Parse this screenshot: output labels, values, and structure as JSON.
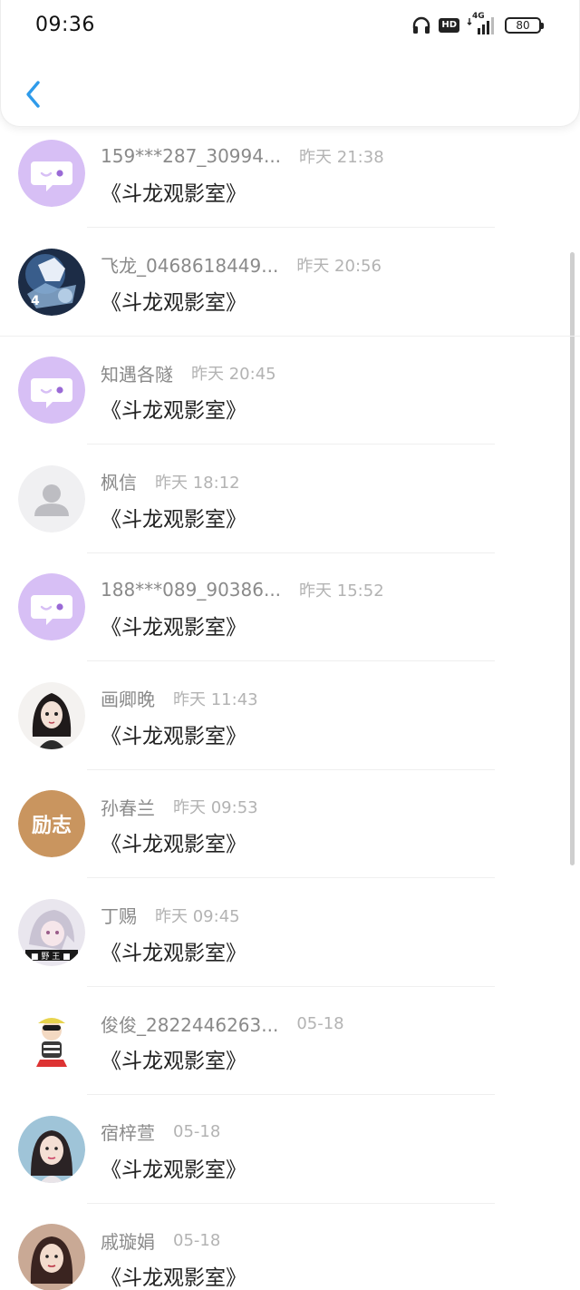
{
  "status_bar": {
    "time": "09:36",
    "icons": [
      "headphones-icon",
      "hd-icon",
      "signal-4g-icon"
    ],
    "hd_label": "HD",
    "network_label": "4G",
    "battery_level": "80"
  },
  "header": {
    "back_icon": "chevron-left-icon",
    "accent_color": "#2f9bea"
  },
  "conversations": [
    {
      "name": "159***287_30994...",
      "time": "昨天 21:38",
      "message": "《斗龙观影室》",
      "avatar": "default-chat-avatar"
    },
    {
      "name": "飞龙_0468618449...",
      "time": "昨天 20:56",
      "message": "《斗龙观影室》",
      "avatar": "anime-boy-avatar"
    },
    {
      "name": "知遇各隧",
      "time": "昨天 20:45",
      "message": "《斗龙观影室》",
      "avatar": "default-chat-avatar"
    },
    {
      "name": "枫信",
      "time": "昨天 18:12",
      "message": "《斗龙观影室》",
      "avatar": "default-person-avatar"
    },
    {
      "name": "188***089_90386...",
      "time": "昨天 15:52",
      "message": "《斗龙观影室》",
      "avatar": "default-chat-avatar"
    },
    {
      "name": "画卿晚",
      "time": "昨天 11:43",
      "message": "《斗龙观影室》",
      "avatar": "drawn-girl-avatar"
    },
    {
      "name": "孙春兰",
      "time": "昨天 09:53",
      "message": "《斗龙观影室》",
      "avatar": "text-avatar",
      "avatar_text": "励志",
      "avatar_color": "#c9955f"
    },
    {
      "name": "丁赐",
      "time": "昨天 09:45",
      "message": "《斗龙观影室》",
      "avatar": "anime-girl-avatar"
    },
    {
      "name": "俊俊_2822446263...",
      "time": "05-18",
      "message": "《斗龙观影室》",
      "avatar": "cartoon-kid-avatar"
    },
    {
      "name": "宿梓萱",
      "time": "05-18",
      "message": "《斗龙观影室》",
      "avatar": "photo-girl-avatar"
    },
    {
      "name": "戚璇娟",
      "time": "05-18",
      "message": "《斗龙观影室》",
      "avatar": "photo-woman-avatar"
    }
  ],
  "colors": {
    "chat_avatar_bg": "#d7bff5",
    "person_avatar_bg": "#f0f0f2"
  }
}
